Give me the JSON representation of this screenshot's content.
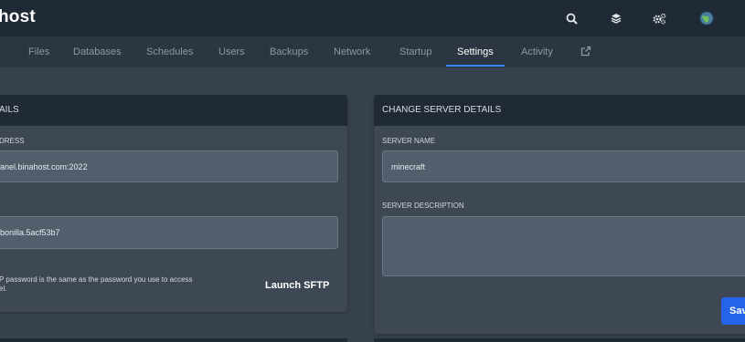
{
  "header": {
    "brand": "host"
  },
  "icons": {
    "search": "search-icon",
    "layers": "layers-icon",
    "settings": "cogs-icon",
    "avatar": "avatar-globe"
  },
  "nav": {
    "tabs": [
      {
        "label": "Files"
      },
      {
        "label": "Databases"
      },
      {
        "label": "Schedules"
      },
      {
        "label": "Users"
      },
      {
        "label": "Backups"
      },
      {
        "label": "Network"
      },
      {
        "label": "Startup"
      },
      {
        "label": "Settings"
      },
      {
        "label": "Activity"
      }
    ],
    "active_tab": "Settings"
  },
  "sftp_card": {
    "title": "AILS",
    "address_label": "DRESS",
    "address_value": "anel.binahost.com:2022",
    "username_value": "bonilla.5acf53b7",
    "note_line1": "P password is the same as the password you use to access",
    "note_line2": "el.",
    "launch_label": "Launch SFTP"
  },
  "details_card": {
    "title": "CHANGE SERVER DETAILS",
    "name_label": "SERVER NAME",
    "name_value": "minecraft",
    "description_label": "SERVER DESCRIPTION",
    "description_value": "",
    "save_label": "Sav"
  },
  "colors": {
    "page_bg": "#37414d",
    "topbar_bg": "#1f2a36",
    "card_bg": "#3d4854",
    "accent": "#3b82f6",
    "save_button": "#2563eb"
  }
}
